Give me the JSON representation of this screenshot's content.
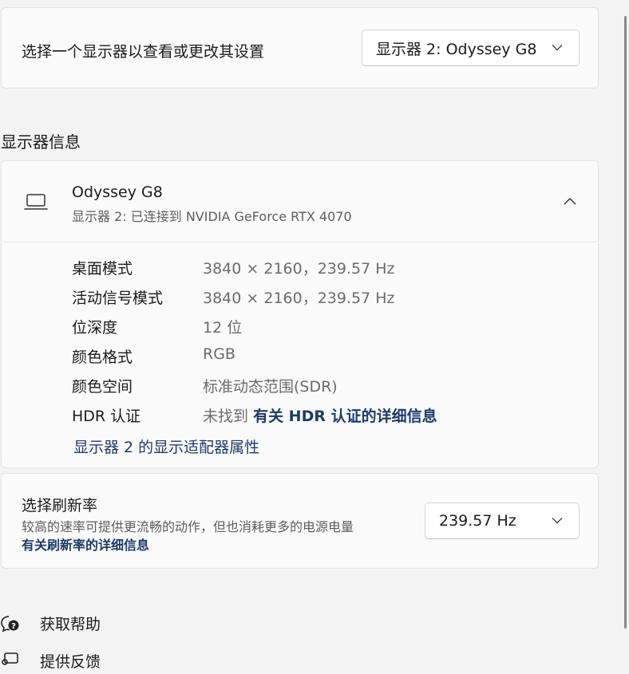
{
  "display_selector": {
    "label": "选择一个显示器以查看或更改其设置",
    "selected": "显示器 2: Odyssey G8"
  },
  "section_title": "显示器信息",
  "display_info": {
    "name": "Odyssey G8",
    "subtitle": "显示器 2: 已连接到 NVIDIA GeForce RTX 4070",
    "rows": [
      {
        "key": "桌面模式",
        "value": "3840 × 2160，239.57 Hz"
      },
      {
        "key": "活动信号模式",
        "value": "3840 × 2160，239.57 Hz"
      },
      {
        "key": "位深度",
        "value": "12 位"
      },
      {
        "key": "颜色格式",
        "value": "RGB"
      },
      {
        "key": "颜色空间",
        "value": "标准动态范围(SDR)"
      }
    ],
    "hdr_key": "HDR 认证",
    "hdr_value_prefix": "未找到",
    "hdr_link": "有关 HDR 认证的详细信息",
    "adapter_link": "显示器 2 的显示适配器属性"
  },
  "refresh": {
    "title": "选择刷新率",
    "description": "较高的速率可提供更流畅的动作，但也消耗更多的电源电量",
    "link": "有关刷新率的详细信息",
    "selected": "239.57 Hz"
  },
  "bottom_links": {
    "help": "获取帮助",
    "feedback": "提供反馈"
  }
}
